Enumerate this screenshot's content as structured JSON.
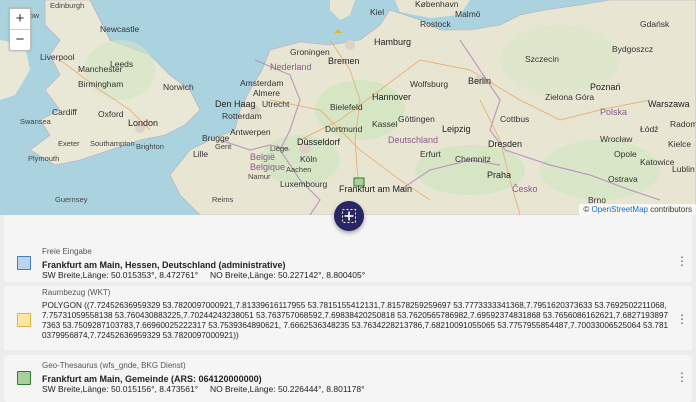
{
  "map": {
    "zoom_in": "+",
    "zoom_out": "−",
    "attribution_prefix": "© ",
    "attribution_link": "OpenStreetMap",
    "attribution_suffix": " contributors",
    "labels": {
      "edinburgh": "Edinburgh",
      "glasgow": "Glasgow",
      "newcastle": "Newcastle",
      "leeds": "Leeds",
      "liverpool": "Liverpool",
      "manchester": "Manchester",
      "birmingham": "Birmingham",
      "norwich": "Norwich",
      "cardiff": "Cardiff",
      "london": "London",
      "oxford": "Oxford",
      "swansea": "Swansea",
      "exeter": "Exeter",
      "plymouth": "Plymouth",
      "portsmouth": "Portsmouth",
      "brighton": "Brighton",
      "southampton": "Southampton",
      "guernsey": "Guernsey",
      "groningen": "Groningen",
      "nederland": "Nederland",
      "amsterdam": "Amsterdam",
      "den_haag": "Den Haag",
      "rotterdam": "Rotterdam",
      "antwerpen": "Antwerpen",
      "brugge": "Brugge",
      "gent": "Gent",
      "belgie": "België",
      "belgique": "Belgique",
      "lille": "Lille",
      "hamburg": "Hamburg",
      "bremen": "Bremen",
      "hannover": "Hannover",
      "berlin": "Berlin",
      "leipzig": "Leipzig",
      "dresden": "Dresden",
      "deutschland": "Deutschland",
      "dusseldorf": "Düsseldorf",
      "koln": "Köln",
      "dortmund": "Dortmund",
      "bielefeld": "Bielefeld",
      "frankfurt": "Frankfurt am Main",
      "luxembourg": "Luxembourg",
      "praha": "Praha",
      "cesko": "Česko",
      "poznan": "Poznań",
      "wroclaw": "Wrocław",
      "lodz": "Łódź",
      "warszawa": "Warszawa",
      "polska": "Polska",
      "bydgoszcz": "Bydgoszcz",
      "szczecin": "Szczecin",
      "gdansk": "Gdańsk",
      "katowice": "Katowice",
      "ostrava": "Ostrava",
      "malmo": "Malmö",
      "kobenhavn": "København",
      "kiel": "Kiel",
      "rostock": "Rostock",
      "chemnitz": "Chemnitz",
      "erfurt": "Erfurt",
      "kassel": "Kassel",
      "lublin": "Lublin",
      "radom": "Radom",
      "kielce": "Kielce",
      "opole": "Opole",
      "zielona": "Zielona Góra",
      "cottbus": "Cottbus",
      "wolfsburg": "Wolfsburg",
      "gottingen": "Göttingen",
      "brno": "Brno",
      "reims": "Reims",
      "namur": "Namur",
      "liege": "Liège",
      "aachen": "Aachen",
      "utrecht": "Utrecht",
      "almere": "Almere"
    }
  },
  "results": [
    {
      "category": "Freie Eingabe",
      "title": "Frankfurt am Main, Hessen, Deutschland (administrative)",
      "coords": "SW Breite,Länge: 50.015353°, 8.472761°     NO Breite,Länge: 50.227142°, 8.800405°",
      "swatch_border": "#3f7fbf",
      "swatch_fill": "#bcd4ec"
    },
    {
      "category": "Raumbezug (WKT)",
      "wkt": "POLYGON ((7.72452636959329 53.7820097000921,7.81339616117955 53.7815155412131,7.81578259259697 53.7773333341368,7.7951620373633 53.7692502211068,7.75731059558138 53.760430883225,7.70244243238051 53.763757068592,7.69838420250818 53.7620565786982,7.69592374831868 53.7656086162621,7.68271938977363 53.7509287103783,7.66960025222317 53.7539364890621, 7.6662536348235 53.7634228213786,7.68210091055065 53.7757955854487,7.70033006525064 53.7810379956874,7.72452636959329 53.7820097000921))",
      "swatch_border": "#e0b63a",
      "swatch_fill": "#fbe6a4"
    },
    {
      "category": "Geo-Thesaurus (wfs_gnde, BKG Dienst)",
      "title": "Frankfurt am Main, Gemeinde (ARS: 064120000000)",
      "coords": "SW Breite,Länge: 50.015156°, 8.473561°     NO Breite,Länge: 50.226444°, 8.801178°",
      "swatch_border": "#2f7a35",
      "swatch_fill": "#a7cf9a"
    }
  ]
}
